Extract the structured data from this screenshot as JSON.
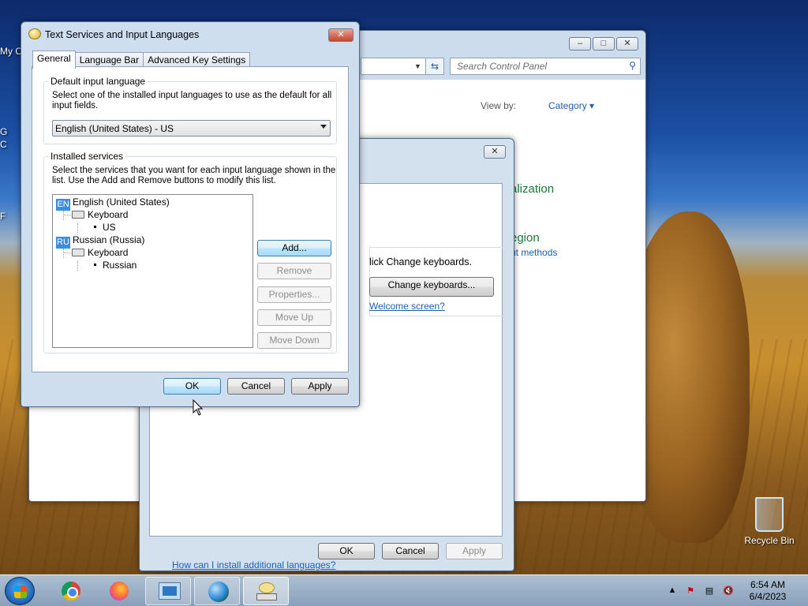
{
  "desktop": {
    "left_icons": [
      "My C",
      "G",
      "C",
      "F"
    ],
    "recycle_bin": "Recycle Bin"
  },
  "control_panel": {
    "search_placeholder": "Search Control Panel",
    "view_by_label": "View by:",
    "view_by_value": "Category",
    "partial_heading_1": "alization",
    "partial_heading_2": "egion",
    "partial_link": "ut methods"
  },
  "region_dialog": {
    "partial_text": "lick Change keyboards.",
    "change_keyboards_button": "Change keyboards...",
    "welcome_link": "Welcome screen?",
    "install_link": "How can I install additional languages?",
    "ok": "OK",
    "cancel": "Cancel",
    "apply": "Apply"
  },
  "text_services": {
    "title": "Text Services and Input Languages",
    "tabs": [
      "General",
      "Language Bar",
      "Advanced Key Settings"
    ],
    "default_group": {
      "label": "Default input language",
      "description": "Select one of the installed input languages to use as the default for all input fields.",
      "selected": "English (United States) - US"
    },
    "installed_group": {
      "label": "Installed services",
      "description": "Select the services that you want for each input language shown in the list. Use the Add and Remove buttons to modify this list.",
      "languages": [
        {
          "code": "EN",
          "name": "English (United States)",
          "category": "Keyboard",
          "layout": "US"
        },
        {
          "code": "RU",
          "name": "Russian (Russia)",
          "category": "Keyboard",
          "layout": "Russian"
        }
      ],
      "buttons": {
        "add": "Add...",
        "remove": "Remove",
        "properties": "Properties...",
        "move_up": "Move Up",
        "move_down": "Move Down"
      }
    },
    "ok": "OK",
    "cancel": "Cancel",
    "apply": "Apply"
  },
  "taskbar": {
    "time": "6:54 AM",
    "date": "6/4/2023"
  }
}
